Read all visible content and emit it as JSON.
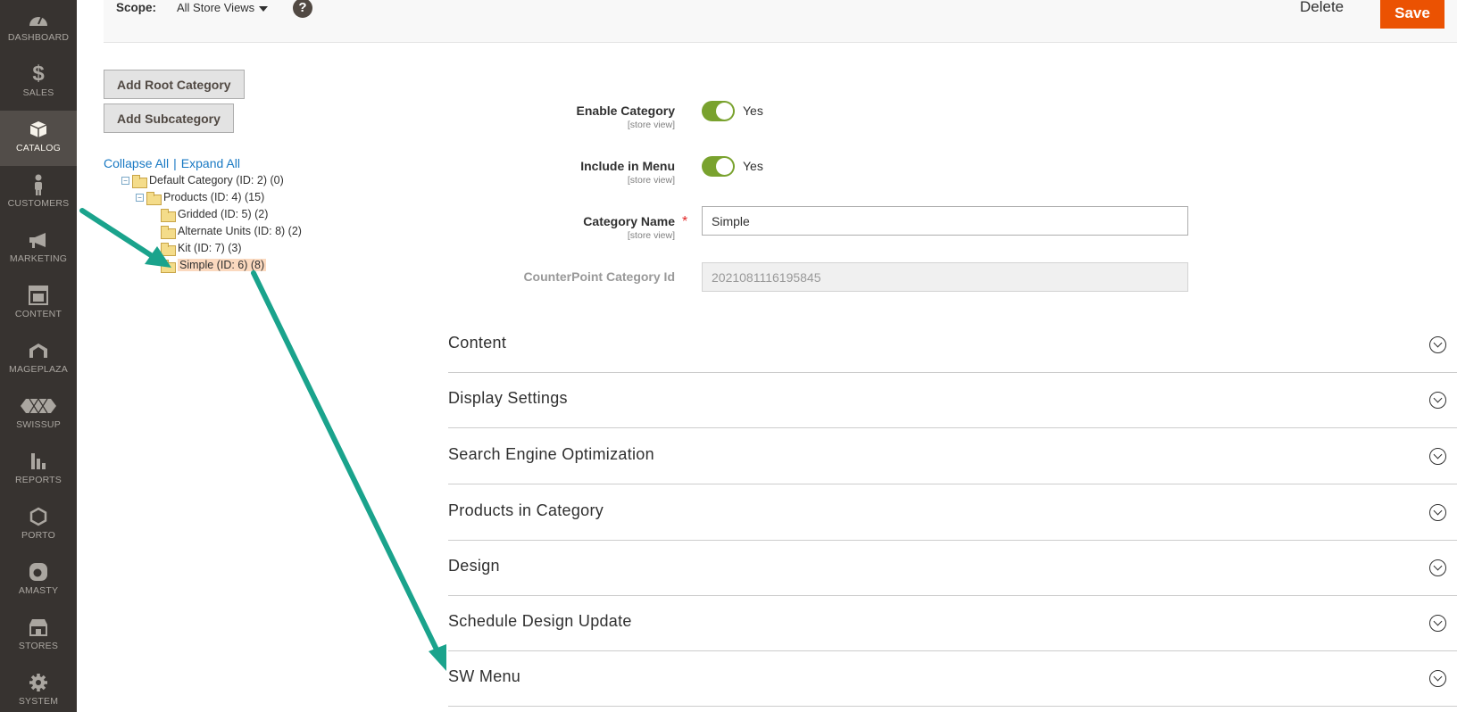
{
  "sidebar": {
    "items": [
      {
        "label": "DASHBOARD",
        "icon": "dashboard-icon"
      },
      {
        "label": "SALES",
        "icon": "dollar-icon"
      },
      {
        "label": "CATALOG",
        "icon": "box-icon",
        "active": true
      },
      {
        "label": "CUSTOMERS",
        "icon": "person-icon"
      },
      {
        "label": "MARKETING",
        "icon": "megaphone-icon"
      },
      {
        "label": "CONTENT",
        "icon": "layout-icon"
      },
      {
        "label": "MAGEPLAZA",
        "icon": "mageplaza-icon"
      },
      {
        "label": "SWISSUP",
        "icon": "swissup-icon"
      },
      {
        "label": "REPORTS",
        "icon": "bar-chart-icon"
      },
      {
        "label": "PORTO",
        "icon": "hexagon-icon"
      },
      {
        "label": "AMASTY",
        "icon": "amasty-icon"
      },
      {
        "label": "STORES",
        "icon": "store-icon"
      },
      {
        "label": "SYSTEM",
        "icon": "gear-icon"
      }
    ]
  },
  "header": {
    "scope_label": "Scope:",
    "scope_value": "All Store Views",
    "help": "?",
    "delete_label": "Delete",
    "save_label": "Save"
  },
  "tree": {
    "add_root": "Add Root Category",
    "add_sub": "Add Subcategory",
    "collapse_all": "Collapse All",
    "separator": "|",
    "expand_all": "Expand All",
    "nodes": [
      {
        "label": "Default Category (ID: 2) (0)"
      },
      {
        "label": "Products (ID: 4) (15)"
      },
      {
        "label": "Gridded (ID: 5) (2)"
      },
      {
        "label": "Alternate Units (ID: 8) (2)"
      },
      {
        "label": "Kit (ID: 7) (3)"
      },
      {
        "label": "Simple (ID: 6) (8)",
        "selected": true
      }
    ]
  },
  "form": {
    "enable_category": {
      "label": "Enable Category",
      "scope": "[store view]",
      "value": "Yes"
    },
    "include_in_menu": {
      "label": "Include in Menu",
      "scope": "[store view]",
      "value": "Yes"
    },
    "category_name": {
      "label": "Category Name",
      "scope": "[store view]",
      "value": "Simple",
      "required": "*"
    },
    "counterpoint_id": {
      "label": "CounterPoint Category Id",
      "value": "2021081116195845"
    }
  },
  "sections": [
    "Content",
    "Display Settings",
    "Search Engine Optimization",
    "Products in Category",
    "Design",
    "Schedule Design Update",
    "SW Menu"
  ],
  "colors": {
    "sidebar_bg": "#373330",
    "accent_orange": "#eb5202",
    "toggle_on": "#79a22e",
    "link_blue": "#1979c3",
    "annotation_arrow": "#1aa38c"
  }
}
